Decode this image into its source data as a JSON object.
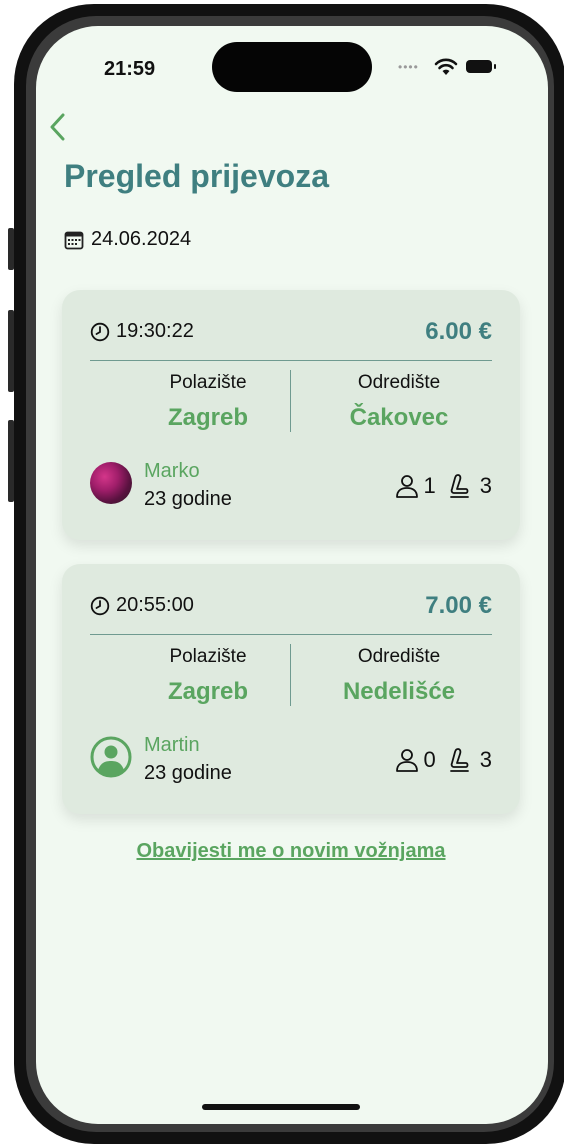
{
  "status": {
    "time": "21:59"
  },
  "header": {
    "title": "Pregled prijevoza",
    "date": "24.06.2024"
  },
  "rides": [
    {
      "time": "19:30:22",
      "price": "6.00 €",
      "origin_label": "Polazište",
      "origin": "Zagreb",
      "destination_label": "Odredište",
      "destination": "Čakovec",
      "driver_name": "Marko",
      "driver_age": "23 godine",
      "passengers": "1",
      "seats": "3",
      "avatar": "photo"
    },
    {
      "time": "20:55:00",
      "price": "7.00 €",
      "origin_label": "Polazište",
      "origin": "Zagreb",
      "destination_label": "Odredište",
      "destination": "Nedelišće",
      "driver_name": "Martin",
      "driver_age": "23 godine",
      "passengers": "0",
      "seats": "3",
      "avatar": "default-user-icon"
    }
  ],
  "notify_link": "Obavijesti me o novim vožnjama",
  "colors": {
    "title": "#3f7f80",
    "accent_green": "#5aa560",
    "card_bg": "#dfeadf",
    "screen_bg": "#f1f9f1"
  },
  "icons": [
    "back-chevron-icon",
    "calendar-icon",
    "clock-icon",
    "person-icon",
    "seat-icon",
    "wifi-icon",
    "battery-icon"
  ]
}
